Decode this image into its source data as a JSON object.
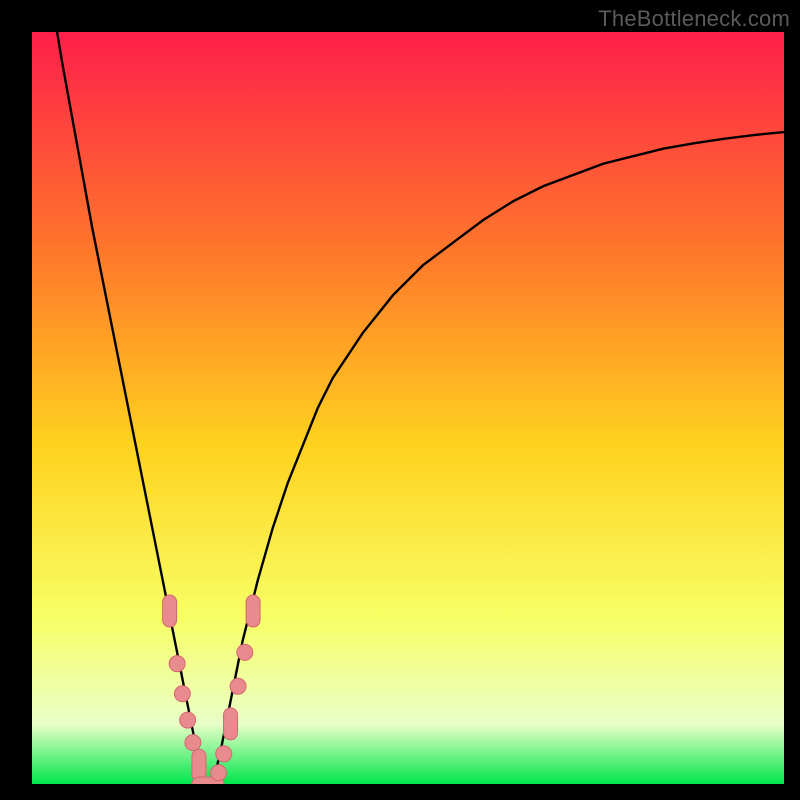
{
  "watermark": "TheBottleneck.com",
  "colors": {
    "frame": "#000000",
    "gradient_top": "#ff1f4b",
    "gradient_upper_mid": "#ff7a2a",
    "gradient_mid": "#ffd21f",
    "gradient_lower_mid": "#f7ff66",
    "gradient_near_bottom": "#eaffc8",
    "gradient_bottom": "#00e64d",
    "curve": "#000000",
    "marker_fill": "#e98a8f",
    "marker_stroke": "#d4686f"
  },
  "chart_data": {
    "type": "line",
    "title": "",
    "xlabel": "",
    "ylabel": "",
    "xlim": [
      0,
      100
    ],
    "ylim": [
      0,
      100
    ],
    "grid": false,
    "series": [
      {
        "name": "bottleneck-curve",
        "x": [
          0,
          2,
          4,
          6,
          8,
          10,
          12,
          14,
          16,
          18,
          19,
          20,
          21,
          22,
          23,
          24,
          25,
          26,
          27,
          28,
          30,
          32,
          34,
          36,
          38,
          40,
          44,
          48,
          52,
          56,
          60,
          64,
          68,
          72,
          76,
          80,
          84,
          88,
          92,
          96,
          100
        ],
        "values": [
          120,
          108,
          96,
          85,
          74,
          64,
          54,
          44,
          34,
          24,
          19,
          14,
          9,
          4,
          0,
          0,
          4,
          9,
          14,
          19,
          27,
          34,
          40,
          45,
          50,
          54,
          60,
          65,
          69,
          72,
          75,
          77.5,
          79.5,
          81,
          82.5,
          83.5,
          84.5,
          85.2,
          85.8,
          86.3,
          86.7
        ]
      }
    ],
    "markers": {
      "name": "highlighted-points",
      "points": [
        {
          "x": 18.3,
          "y": 23.0,
          "shape": "pill"
        },
        {
          "x": 19.3,
          "y": 16.0,
          "shape": "round"
        },
        {
          "x": 20.0,
          "y": 12.0,
          "shape": "round"
        },
        {
          "x": 20.7,
          "y": 8.5,
          "shape": "round"
        },
        {
          "x": 21.4,
          "y": 5.5,
          "shape": "round"
        },
        {
          "x": 22.2,
          "y": 2.5,
          "shape": "pill"
        },
        {
          "x": 23.4,
          "y": 0.0,
          "shape": "pill-h"
        },
        {
          "x": 24.8,
          "y": 1.5,
          "shape": "round"
        },
        {
          "x": 25.5,
          "y": 4.0,
          "shape": "round"
        },
        {
          "x": 26.4,
          "y": 8.0,
          "shape": "pill"
        },
        {
          "x": 27.4,
          "y": 13.0,
          "shape": "round"
        },
        {
          "x": 28.3,
          "y": 17.5,
          "shape": "round"
        },
        {
          "x": 29.4,
          "y": 23.0,
          "shape": "pill"
        }
      ]
    }
  }
}
